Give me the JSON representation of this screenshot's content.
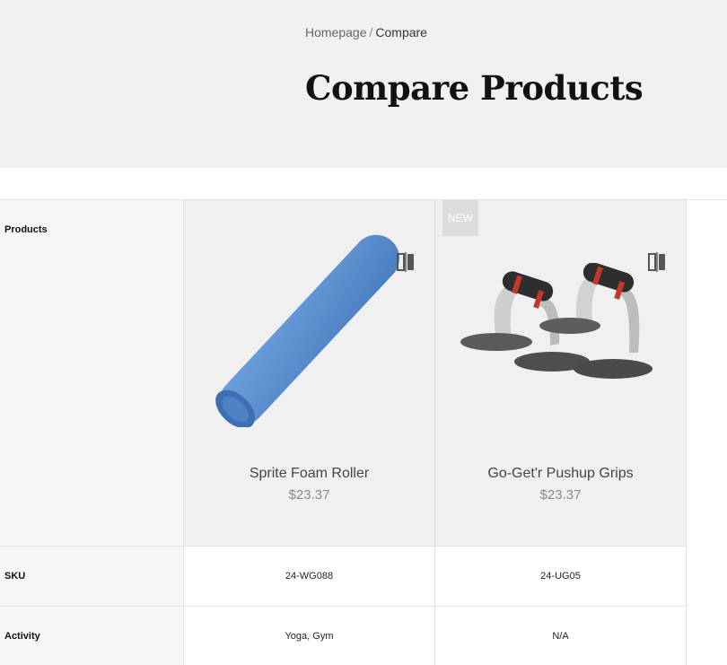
{
  "breadcrumb": {
    "home": "Homepage",
    "separator": "/",
    "current": "Compare"
  },
  "page": {
    "title": "Compare Products"
  },
  "labels": {
    "products": "Products",
    "sku": "SKU",
    "activity": "Activity"
  },
  "products": [
    {
      "name": "Sprite Foam Roller",
      "price": "$23.37",
      "sku": "24-WG088",
      "activity": "Yoga, Gym",
      "badge": "",
      "image": "foam-roller"
    },
    {
      "name": "Go-Get'r Pushup Grips",
      "price": "$23.37",
      "sku": "24-UG05",
      "activity": "N/A",
      "badge": "NEW",
      "image": "pushup-grips"
    }
  ],
  "colors": {
    "hero_bg": "#f1f1f1",
    "product_cell_bg": "#f0f0f0",
    "label_col_bg": "#f7f7f7",
    "roller_blue": "#5b8fd0"
  },
  "icons": {
    "compare": "compare-remove-icon"
  }
}
